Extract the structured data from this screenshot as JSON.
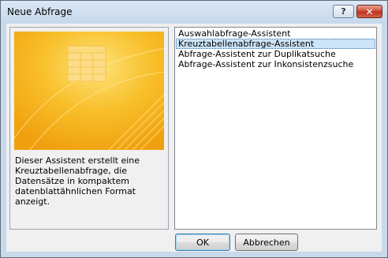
{
  "window": {
    "title": "Neue Abfrage"
  },
  "titlebar_buttons": {
    "help_label": "?",
    "close_label": "✕"
  },
  "description": "Dieser Assistent erstellt eine Kreuztabellenabfrage, die Datensätze in kompaktem datenblattähnlichen Format anzeigt.",
  "wizards": [
    {
      "label": "Auswahlabfrage-Assistent",
      "selected": false
    },
    {
      "label": "Kreuztabellenabfrage-Assistent",
      "selected": true
    },
    {
      "label": "Abfrage-Assistent zur Duplikatsuche",
      "selected": false
    },
    {
      "label": "Abfrage-Assistent zur Inkonsistenzsuche",
      "selected": false
    }
  ],
  "buttons": {
    "ok": "OK",
    "cancel": "Abbrechen"
  },
  "colors": {
    "preview_bg": "#f6b31c",
    "selection_bg": "#cce4f7",
    "titlebar": "#c6d8ec"
  }
}
